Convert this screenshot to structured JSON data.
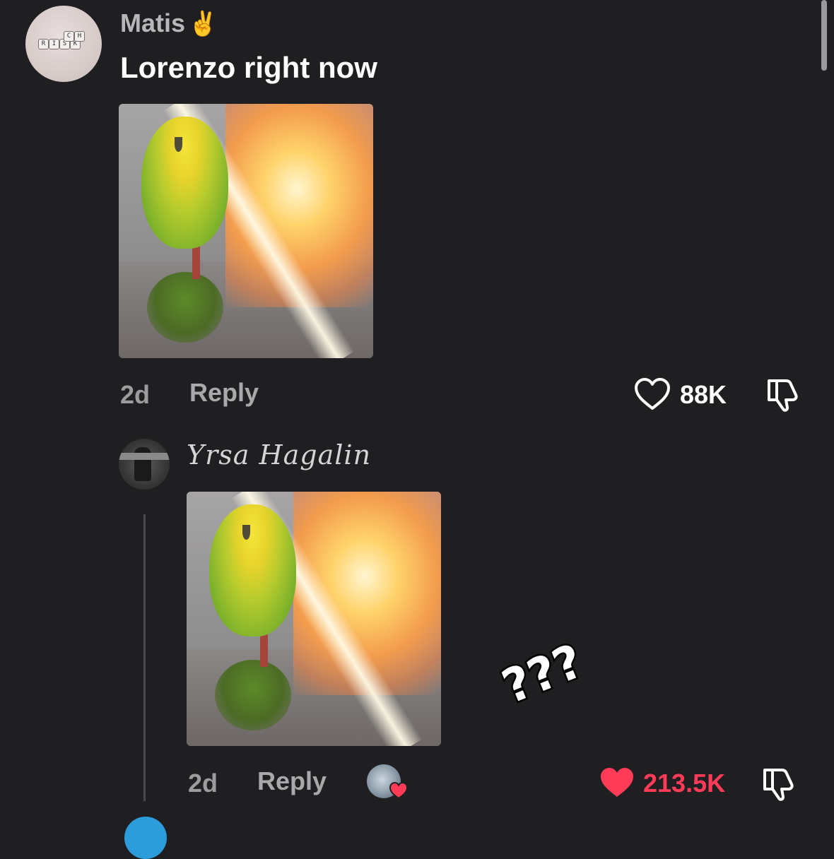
{
  "comment": {
    "username": "Matis",
    "username_emoji": "✌️",
    "text": "Lorenzo right now",
    "avatar_text": "RISK",
    "avatar_small_text": "CH",
    "time": "2d",
    "reply_label": "Reply",
    "likes": "88K",
    "liked": false
  },
  "reply": {
    "username": "Yrsa Hagalin",
    "time": "2d",
    "reply_label": "Reply",
    "likes": "213.5K",
    "liked": true,
    "overlay_text": "???"
  },
  "colors": {
    "background": "#1f1f21",
    "like_red": "#ff3b57",
    "muted_text": "#9c9c9e"
  },
  "icons": [
    "heart-outline-icon",
    "heart-filled-icon",
    "thumbs-down-icon",
    "creator-liked-badge-icon"
  ]
}
